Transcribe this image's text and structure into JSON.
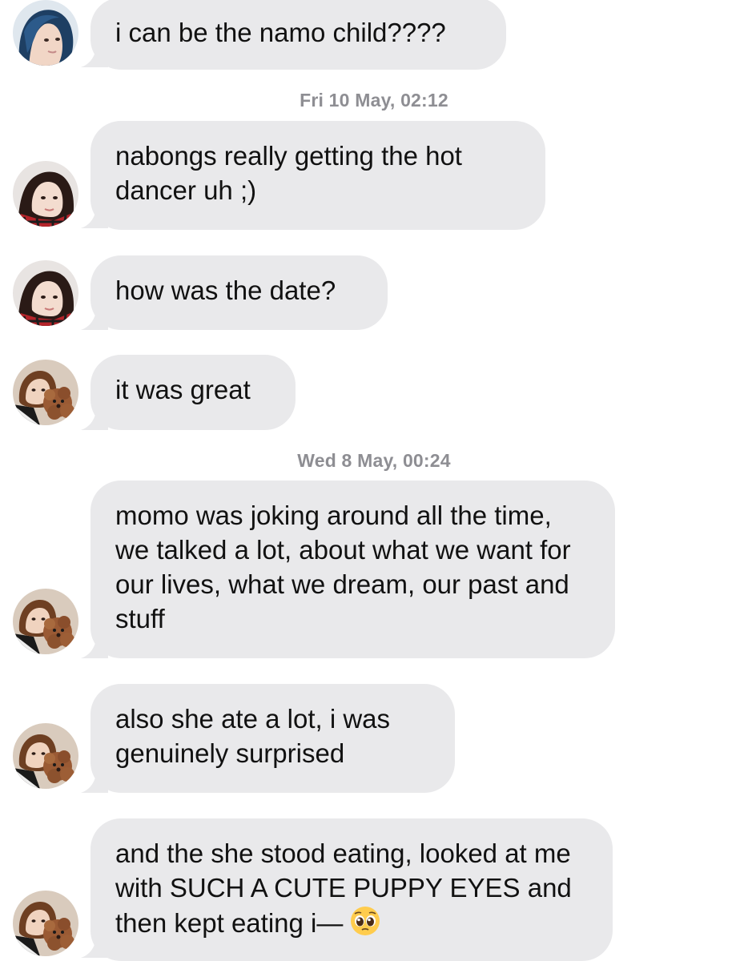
{
  "conversation": {
    "accent_bubble_color": "#e9e9eb",
    "timestamp_color": "#8e8e93",
    "timestamps": [
      "Fri 10 May, 02:12",
      "Wed 8 May, 00:24"
    ],
    "messages": [
      {
        "sender_avatar": "avatar-blue-hair",
        "text": "i can be the namo child????"
      },
      {
        "sender_avatar": "avatar-red-plaid",
        "text": "nabongs really getting the hot dancer uh ;)"
      },
      {
        "sender_avatar": "avatar-red-plaid",
        "text": "how was the date?"
      },
      {
        "sender_avatar": "avatar-with-puppy",
        "text": "it was great"
      },
      {
        "sender_avatar": "avatar-with-puppy",
        "text": "momo was joking around all the time, we talked a lot, about what we want for our lives, what we dream, our past and stuff"
      },
      {
        "sender_avatar": "avatar-with-puppy",
        "text": "also she ate a lot, i was genuinely surprised"
      },
      {
        "sender_avatar": "avatar-with-puppy",
        "text": "and the she stood eating, looked at me with SUCH A CUTE PUPPY EYES and then kept eating i—",
        "trailing_emoji": "pleading-face-emoji"
      }
    ]
  }
}
